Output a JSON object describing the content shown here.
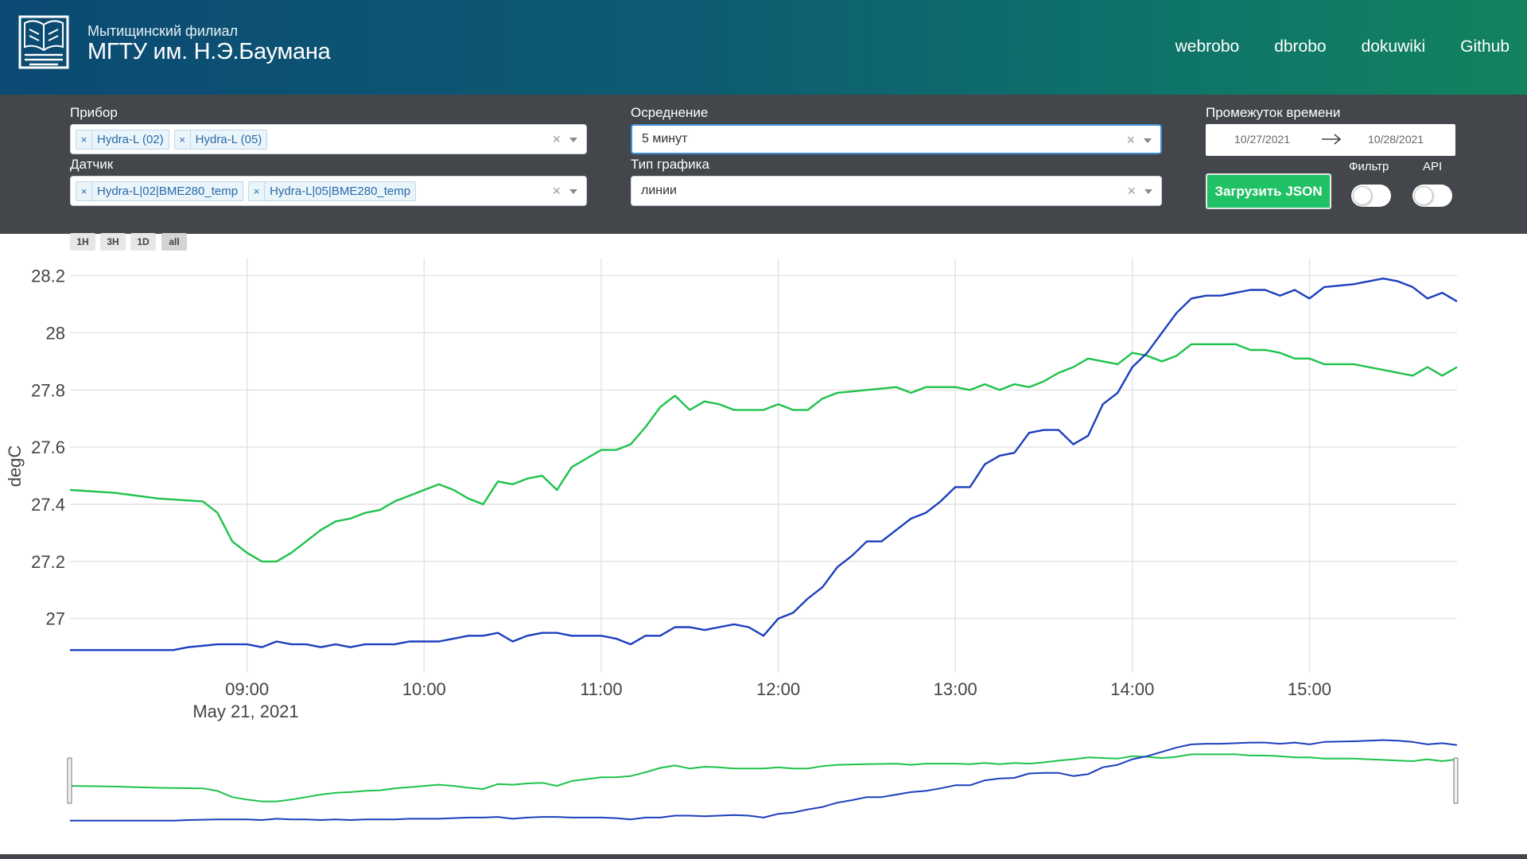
{
  "header": {
    "org_subtitle": "Мытищинский филиал",
    "org_title": "МГТУ им. Н.Э.Баумана",
    "nav": [
      {
        "label": "webrobo"
      },
      {
        "label": "dbrobo"
      },
      {
        "label": "dokuwiki"
      },
      {
        "label": "Github"
      }
    ]
  },
  "filters": {
    "device": {
      "label": "Прибор",
      "chips": [
        "Hydra-L (02)",
        "Hydra-L (05)"
      ]
    },
    "sensor": {
      "label": "Датчик",
      "chips": [
        "Hydra-L|02|BME280_temp",
        "Hydra-L|05|BME280_temp"
      ]
    },
    "averaging": {
      "label": "Осреднение",
      "value": "5 минут"
    },
    "chart_type": {
      "label": "Тип графика",
      "value": "линии"
    },
    "time_range": {
      "label": "Промежуток времени",
      "start": "10/27/2021",
      "end": "10/28/2021"
    },
    "load_button": "Загрузить JSON",
    "filter_toggle": {
      "label": "Фильтр",
      "on": false
    },
    "api_toggle": {
      "label": "API",
      "on": false
    },
    "clear_symbol": "×",
    "chip_remove_symbol": "×"
  },
  "range_buttons": [
    {
      "label": "1H",
      "active": false
    },
    {
      "label": "3H",
      "active": false
    },
    {
      "label": "1D",
      "active": false
    },
    {
      "label": "all",
      "active": true
    }
  ],
  "chart_data": {
    "type": "line",
    "ylabel": "degC",
    "xlabel": "",
    "ylim": [
      26.81,
      28.26
    ],
    "yticks": [
      27,
      27.2,
      27.4,
      27.6,
      27.8,
      28,
      28.2
    ],
    "ytick_labels": [
      "27",
      "27.2",
      "27.4",
      "27.6",
      "27.8",
      "28",
      "28.2"
    ],
    "xlim": [
      "08:00",
      "15:50"
    ],
    "xticks": [
      "09:00",
      "10:00",
      "11:00",
      "12:00",
      "13:00",
      "14:00",
      "15:00"
    ],
    "date_label": "May 21, 2021",
    "grid": true,
    "rangeslider": true,
    "series": [
      {
        "color": "#1ec24b",
        "points": [
          [
            "08:00",
            27.45
          ],
          [
            "08:15",
            27.44
          ],
          [
            "08:30",
            27.42
          ],
          [
            "08:45",
            27.41
          ],
          [
            "08:50",
            27.37
          ],
          [
            "08:55",
            27.27
          ],
          [
            "09:00",
            27.23
          ],
          [
            "09:05",
            27.2
          ],
          [
            "09:10",
            27.2
          ],
          [
            "09:15",
            27.23
          ],
          [
            "09:20",
            27.27
          ],
          [
            "09:25",
            27.31
          ],
          [
            "09:30",
            27.34
          ],
          [
            "09:35",
            27.35
          ],
          [
            "09:40",
            27.37
          ],
          [
            "09:45",
            27.38
          ],
          [
            "09:50",
            27.41
          ],
          [
            "09:55",
            27.43
          ],
          [
            "10:00",
            27.45
          ],
          [
            "10:05",
            27.47
          ],
          [
            "10:10",
            27.45
          ],
          [
            "10:15",
            27.42
          ],
          [
            "10:20",
            27.4
          ],
          [
            "10:25",
            27.48
          ],
          [
            "10:30",
            27.47
          ],
          [
            "10:35",
            27.49
          ],
          [
            "10:40",
            27.5
          ],
          [
            "10:45",
            27.45
          ],
          [
            "10:50",
            27.53
          ],
          [
            "10:55",
            27.56
          ],
          [
            "11:00",
            27.59
          ],
          [
            "11:05",
            27.59
          ],
          [
            "11:10",
            27.61
          ],
          [
            "11:15",
            27.67
          ],
          [
            "11:20",
            27.74
          ],
          [
            "11:25",
            27.78
          ],
          [
            "11:30",
            27.73
          ],
          [
            "11:35",
            27.76
          ],
          [
            "11:40",
            27.75
          ],
          [
            "11:45",
            27.73
          ],
          [
            "11:50",
            27.73
          ],
          [
            "11:55",
            27.73
          ],
          [
            "12:00",
            27.75
          ],
          [
            "12:05",
            27.73
          ],
          [
            "12:10",
            27.73
          ],
          [
            "12:15",
            27.77
          ],
          [
            "12:20",
            27.79
          ],
          [
            "12:30",
            27.8
          ],
          [
            "12:40",
            27.81
          ],
          [
            "12:45",
            27.79
          ],
          [
            "12:50",
            27.81
          ],
          [
            "13:00",
            27.81
          ],
          [
            "13:05",
            27.8
          ],
          [
            "13:10",
            27.82
          ],
          [
            "13:15",
            27.8
          ],
          [
            "13:20",
            27.82
          ],
          [
            "13:25",
            27.81
          ],
          [
            "13:30",
            27.83
          ],
          [
            "13:35",
            27.86
          ],
          [
            "13:40",
            27.88
          ],
          [
            "13:45",
            27.91
          ],
          [
            "13:55",
            27.89
          ],
          [
            "14:00",
            27.93
          ],
          [
            "14:05",
            27.92
          ],
          [
            "14:10",
            27.9
          ],
          [
            "14:15",
            27.92
          ],
          [
            "14:20",
            27.96
          ],
          [
            "14:25",
            27.96
          ],
          [
            "14:30",
            27.96
          ],
          [
            "14:35",
            27.96
          ],
          [
            "14:40",
            27.94
          ],
          [
            "14:45",
            27.94
          ],
          [
            "14:50",
            27.93
          ],
          [
            "14:55",
            27.91
          ],
          [
            "15:00",
            27.91
          ],
          [
            "15:05",
            27.89
          ],
          [
            "15:15",
            27.89
          ],
          [
            "15:20",
            27.88
          ],
          [
            "15:25",
            27.87
          ],
          [
            "15:30",
            27.86
          ],
          [
            "15:35",
            27.85
          ],
          [
            "15:40",
            27.88
          ],
          [
            "15:45",
            27.85
          ],
          [
            "15:50",
            27.88
          ]
        ]
      },
      {
        "color": "#1b3fbd",
        "points": [
          [
            "08:00",
            26.89
          ],
          [
            "08:05",
            26.89
          ],
          [
            "08:15",
            26.89
          ],
          [
            "08:30",
            26.89
          ],
          [
            "08:35",
            26.89
          ],
          [
            "08:40",
            26.9
          ],
          [
            "08:50",
            26.91
          ],
          [
            "09:00",
            26.91
          ],
          [
            "09:05",
            26.9
          ],
          [
            "09:10",
            26.92
          ],
          [
            "09:15",
            26.91
          ],
          [
            "09:20",
            26.91
          ],
          [
            "09:25",
            26.9
          ],
          [
            "09:30",
            26.91
          ],
          [
            "09:35",
            26.9
          ],
          [
            "09:40",
            26.91
          ],
          [
            "09:50",
            26.91
          ],
          [
            "09:55",
            26.92
          ],
          [
            "10:00",
            26.92
          ],
          [
            "10:05",
            26.92
          ],
          [
            "10:10",
            26.93
          ],
          [
            "10:15",
            26.94
          ],
          [
            "10:20",
            26.94
          ],
          [
            "10:25",
            26.95
          ],
          [
            "10:30",
            26.92
          ],
          [
            "10:35",
            26.94
          ],
          [
            "10:40",
            26.95
          ],
          [
            "10:45",
            26.95
          ],
          [
            "10:50",
            26.94
          ],
          [
            "10:55",
            26.94
          ],
          [
            "11:00",
            26.94
          ],
          [
            "11:05",
            26.93
          ],
          [
            "11:10",
            26.91
          ],
          [
            "11:15",
            26.94
          ],
          [
            "11:20",
            26.94
          ],
          [
            "11:25",
            26.97
          ],
          [
            "11:30",
            26.97
          ],
          [
            "11:35",
            26.96
          ],
          [
            "11:40",
            26.97
          ],
          [
            "11:45",
            26.98
          ],
          [
            "11:50",
            26.97
          ],
          [
            "11:55",
            26.94
          ],
          [
            "12:00",
            27.0
          ],
          [
            "12:05",
            27.02
          ],
          [
            "12:10",
            27.07
          ],
          [
            "12:15",
            27.11
          ],
          [
            "12:20",
            27.18
          ],
          [
            "12:25",
            27.22
          ],
          [
            "12:30",
            27.27
          ],
          [
            "12:35",
            27.27
          ],
          [
            "12:40",
            27.31
          ],
          [
            "12:45",
            27.35
          ],
          [
            "12:50",
            27.37
          ],
          [
            "12:55",
            27.41
          ],
          [
            "13:00",
            27.46
          ],
          [
            "13:05",
            27.46
          ],
          [
            "13:10",
            27.54
          ],
          [
            "13:15",
            27.57
          ],
          [
            "13:20",
            27.58
          ],
          [
            "13:25",
            27.65
          ],
          [
            "13:30",
            27.66
          ],
          [
            "13:35",
            27.66
          ],
          [
            "13:40",
            27.61
          ],
          [
            "13:45",
            27.64
          ],
          [
            "13:50",
            27.75
          ],
          [
            "13:55",
            27.79
          ],
          [
            "14:00",
            27.88
          ],
          [
            "14:05",
            27.93
          ],
          [
            "14:10",
            28.0
          ],
          [
            "14:15",
            28.07
          ],
          [
            "14:20",
            28.12
          ],
          [
            "14:25",
            28.13
          ],
          [
            "14:30",
            28.13
          ],
          [
            "14:35",
            28.14
          ],
          [
            "14:40",
            28.15
          ],
          [
            "14:45",
            28.15
          ],
          [
            "14:50",
            28.13
          ],
          [
            "14:55",
            28.15
          ],
          [
            "15:00",
            28.12
          ],
          [
            "15:05",
            28.16
          ],
          [
            "15:15",
            28.17
          ],
          [
            "15:20",
            28.18
          ],
          [
            "15:25",
            28.19
          ],
          [
            "15:30",
            28.18
          ],
          [
            "15:35",
            28.16
          ],
          [
            "15:40",
            28.12
          ],
          [
            "15:45",
            28.14
          ],
          [
            "15:50",
            28.11
          ]
        ]
      }
    ]
  }
}
